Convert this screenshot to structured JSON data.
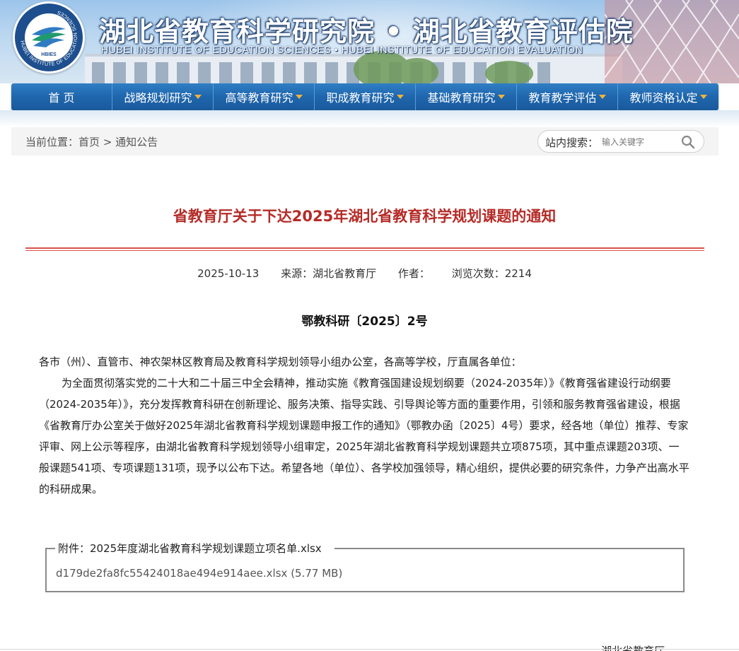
{
  "header": {
    "title_cn": "湖北省教育科学研究院 • 湖北省教育评估院",
    "title_en": "HUBEI INSTITUTE OF EDUCATION SCIENCES  •  HUBEI INSTITUTE OF EDUCATION EVALUATION",
    "logo_text": "HBIES",
    "logo_ring_text": "HUBEI INSTITUTE OF EDUCATION SCIENCES"
  },
  "nav": {
    "items": [
      {
        "label": "首 页",
        "has_dropdown": false
      },
      {
        "label": "战略规划研究",
        "has_dropdown": true
      },
      {
        "label": "高等教育研究",
        "has_dropdown": true
      },
      {
        "label": "职成教育研究",
        "has_dropdown": true
      },
      {
        "label": "基础教育研究",
        "has_dropdown": true
      },
      {
        "label": "教育教学评估",
        "has_dropdown": true
      },
      {
        "label": "教师资格认定",
        "has_dropdown": true
      }
    ],
    "caret_color": "#f2b33a",
    "bg_color": "#1f66ad"
  },
  "location": {
    "label": "当前位置：",
    "crumbs": [
      "首页",
      "通知公告"
    ],
    "separator": ">"
  },
  "search": {
    "label": "站内搜索：",
    "placeholder": "输入关键字"
  },
  "article": {
    "title": "省教育厅关于下达2025年湖北省教育科学规划课题的通知",
    "title_color": "#b52b27",
    "meta": {
      "date": "2025-10-13",
      "source": "来源：湖北省教育厅",
      "author": "作者：",
      "views": "浏览次数：2214"
    },
    "doc_no": "鄂教科研〔2025〕2号",
    "salutation": "各市（州）、直管市、神农架林区教育局及教育科学规划领导小组办公室，各高等学校，厅直属各单位：",
    "paragraph": "为全面贯彻落实党的二十大和二十届三中全会精神，推动实施《教育强国建设规划纲要（2024-2035年）》《教育强省建设行动纲要（2024-2035年）》，充分发挥教育科研在创新理论、服务决策、指导实践、引导舆论等方面的重要作用，引领和服务教育强省建设，根据《省教育厅办公室关于做好2025年湖北省教育科学规划课题申报工作的通知》（鄂教办函〔2025〕4号）要求，经各地（单位）推荐、专家评审、网上公示等程序，由湖北省教育科学规划领导小组审定，2025年湖北省教育科学规划课题共立项875项，其中重点课题203项、一般课题541项、专项课题131项，现予以公布下达。希望各地（单位）、各学校加强领导，精心组织，提供必要的研究条件，力争产出高水平的科研成果。",
    "attachment": {
      "legend": "附件：2025年度湖北省教育科学规划课题立项名单.xlsx",
      "file_name": "d179de2fa8fc55424018ae494e914aee.xlsx",
      "file_size": "(5.77 MB)"
    },
    "signature": "湖北省教育厅"
  }
}
